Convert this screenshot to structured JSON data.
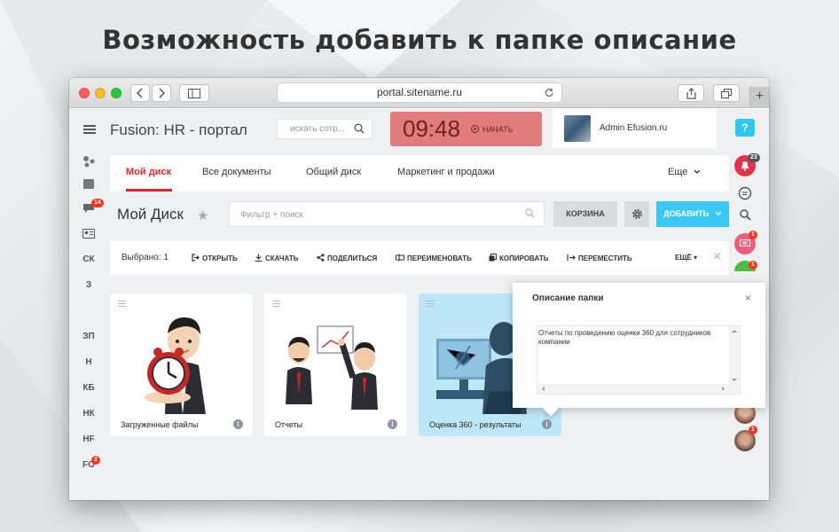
{
  "headline": "Возможность добавить к папке описание",
  "browser": {
    "url": "portal.sitename.ru"
  },
  "header": {
    "app_title": "Fusion: HR - портал",
    "search_placeholder": "искать сотр...",
    "timer": "09:48",
    "timer_start": "НАЧАТЬ",
    "user_name": "Admin Efusion.ru",
    "help": "?"
  },
  "leftnav": {
    "chat_badge": "14",
    "items": [
      "СК",
      "З",
      "ЗП",
      "Н",
      "КБ",
      "НК",
      "HF",
      "FO"
    ],
    "fo_badge": "2"
  },
  "rightnav": {
    "notif_badge": "23",
    "badges": [
      "1",
      "1",
      "1",
      "1",
      "1"
    ]
  },
  "tabs": {
    "items": [
      "Мой диск",
      "Все документы",
      "Общий диск",
      "Маркетинг и продажи"
    ],
    "more": "Еще"
  },
  "toolbar": {
    "title": "Мой Диск",
    "filter_placeholder": "Фильтр + поиск",
    "trash": "КОРЗИНА",
    "add": "ДОБАВИТЬ"
  },
  "actionbar": {
    "selected": "Выбрано: 1",
    "actions": [
      "ОТКРЫТЬ",
      "СКАЧАТЬ",
      "ПОДЕЛИТЬСЯ",
      "ПЕРЕИМЕНОВАТЬ",
      "КОПИРОВАТЬ",
      "ПЕРЕМЕСТИТЬ"
    ],
    "more": "ЕЩЁ"
  },
  "cards": [
    {
      "name": "Загруженные файлы"
    },
    {
      "name": "Отчеты"
    },
    {
      "name": "Оценка 360 - результаты"
    }
  ],
  "popover": {
    "title": "Описание папки",
    "text": "Отчеты по проведению оценки 360 для сотрудников компании"
  },
  "colors": {
    "accent_red": "#e22222",
    "timer_bg": "#e27b7b",
    "add_button": "#3bc8f5",
    "selected_card": "#bde7f7"
  }
}
